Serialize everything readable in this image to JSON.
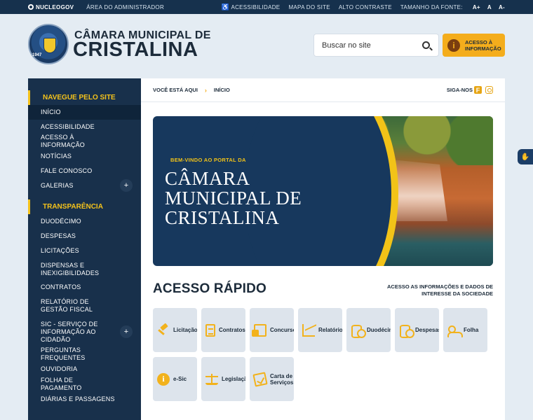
{
  "topbar": {
    "brand": "NUCLEOGOV",
    "admin": "ÁREA DO ADMINISTRADOR",
    "acessibilidade": "ACESSIBILIDADE",
    "mapa": "MAPA DO SITE",
    "contraste": "ALTO CONTRASTE",
    "fonte_label": "TAMANHO DA FONTE:",
    "font_plus": "A+",
    "font_normal": "A",
    "font_minus": "A-"
  },
  "header": {
    "logo_year": "1947",
    "title_line1": "CÂMARA MUNICIPAL DE",
    "title_line2": "CRISTALINA",
    "search_placeholder": "Buscar no site",
    "acesso_button": "ACESSO À INFORMAÇÃO",
    "acesso_icon": "i"
  },
  "sidebar": {
    "section1": "NAVEGUE PELO SITE",
    "items1": [
      {
        "label": "INÍCIO"
      },
      {
        "label": "ACESSIBILIDADE"
      },
      {
        "label": "ACESSO À INFORMAÇÃO"
      },
      {
        "label": "NOTÍCIAS"
      },
      {
        "label": "FALE CONOSCO"
      },
      {
        "label": "GALERIAS"
      }
    ],
    "section2": "TRANSPARÊNCIA",
    "items2": [
      {
        "label": "DUODÉCIMO"
      },
      {
        "label": "DESPESAS"
      },
      {
        "label": "LICITAÇÕES"
      },
      {
        "label": "DISPENSAS E INEXIGIBILIDADES"
      },
      {
        "label": "CONTRATOS"
      },
      {
        "label": "RELATÓRIO DE GESTÃO FISCAL"
      },
      {
        "label": "SIC - SERVIÇO DE INFORMAÇÃO AO CIDADÃO"
      },
      {
        "label": "PERGUNTAS FREQUENTES"
      },
      {
        "label": "OUVIDORIA"
      },
      {
        "label": "FOLHA DE PAGAMENTO"
      },
      {
        "label": "DIÁRIAS E PASSAGENS"
      }
    ],
    "expand_symbol": "+"
  },
  "breadcrumb": {
    "voce_esta": "VOCÊ ESTÁ AQUI",
    "separator": "›",
    "current": "INÍCIO",
    "siga": "SIGA-NOS",
    "facebook_glyph": "f"
  },
  "banner": {
    "welcome": "BEM-VINDO AO PORTAL DA",
    "line1": "CÂMARA",
    "line2": "MUNICIPAL DE",
    "line3": "CRISTALINA"
  },
  "acesso_rapido": {
    "title": "ACESSO RÁPIDO",
    "subtitle": "ACESSO AS INFORMAÇÕES E DADOS DE INTERESSE DA SOCIEDADE",
    "tiles": [
      {
        "label": "Licitação",
        "icon": "gavel-icon"
      },
      {
        "label": "Contratos",
        "icon": "document-icon"
      },
      {
        "label": "Concursos",
        "icon": "documents-icon"
      },
      {
        "label": "Relatórios",
        "icon": "chart-icon"
      },
      {
        "label": "Duodécimo",
        "icon": "coins-icon"
      },
      {
        "label": "Despesas",
        "icon": "coins-icon"
      },
      {
        "label": "Folha",
        "icon": "people-icon"
      },
      {
        "label": "e-Sic",
        "icon": "info-icon"
      },
      {
        "label": "Legislação",
        "icon": "scale-icon"
      },
      {
        "label": "Carta de Serviços",
        "icon": "checklist-icon"
      }
    ],
    "info_glyph": "i"
  },
  "colors": {
    "navy": "#18304b",
    "accent": "#f4ad1c",
    "yellow": "#f4c21b",
    "tile_bg": "#dde4ec"
  }
}
